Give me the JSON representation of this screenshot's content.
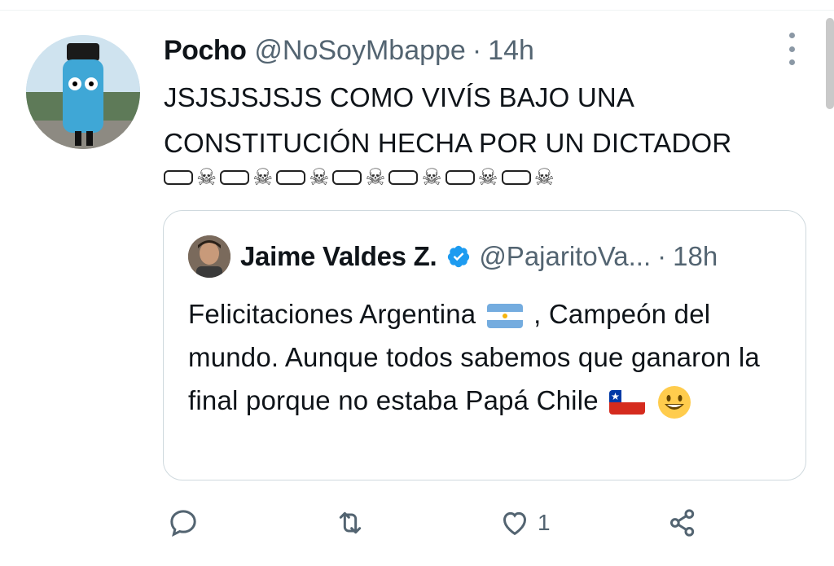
{
  "tweet": {
    "author_name": "Pocho",
    "author_handle": "@NoSoyMbappe",
    "separator": "·",
    "time": "14h",
    "text": "JSJSJSJSJS COMO VIVÍS BAJO UNA CONSTITUCIÓN HECHA POR UN DICTADOR",
    "emoji_row": [
      "coffin-icon",
      "skull-icon",
      "coffin-icon",
      "skull-icon",
      "coffin-icon",
      "skull-icon",
      "coffin-icon",
      "skull-icon",
      "coffin-icon",
      "skull-icon",
      "coffin-icon",
      "skull-icon",
      "coffin-icon",
      "skull-icon"
    ]
  },
  "quoted": {
    "author_name": "Jaime Valdes Z.",
    "author_handle": "@PajaritoVa...",
    "separator": "·",
    "time": "18h",
    "verified": true,
    "text_part1": "Felicitaciones Argentina",
    "text_part2": ", Campeón del mundo. Aunque todos sabemos que ganaron la final porque no estaba Papá Chile",
    "emojis": [
      "argentina-flag",
      "chile-flag",
      "smiling-face"
    ]
  },
  "actions": {
    "reply_count": "",
    "retweet_count": "",
    "like_count": "1",
    "share_label": ""
  },
  "colors": {
    "secondary_text": "#536471",
    "verified_blue": "#1d9bf0",
    "border": "#cfd9de"
  }
}
